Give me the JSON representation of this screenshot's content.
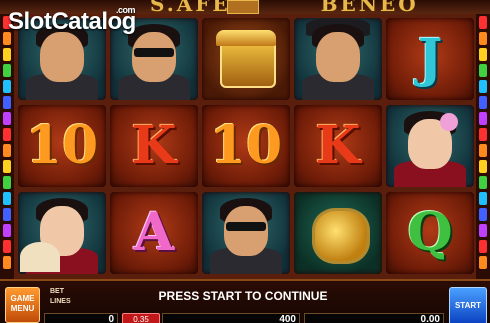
{
  "game": {
    "title_left": "S.AFE",
    "title_right": "BENEO"
  },
  "watermark": {
    "text": "SlotCatalog",
    "suffix": ".com"
  },
  "reels": {
    "columns": [
      [
        "mobster-cigar-portrait",
        "10",
        "geisha-fan-portrait"
      ],
      [
        "mobster-shades-portrait",
        "K",
        "A"
      ],
      [
        "treasure-chest",
        "10",
        "gunman-shades-portrait"
      ],
      [
        "gangster-fedora-portrait",
        "K",
        "fist"
      ],
      [
        "J",
        "geisha-flower-portrait",
        "Q"
      ]
    ],
    "symbol_colors": {
      "10": "orange",
      "K": "red",
      "A": "pink",
      "J": "teal",
      "Q": "green"
    }
  },
  "side_lights": [
    "#ff3030",
    "#ff8a20",
    "#ffd020",
    "#40d040",
    "#20c0ff",
    "#4060ff",
    "#c040ff",
    "#ff3030",
    "#ff8a20",
    "#ffd020",
    "#40d040",
    "#20c0ff",
    "#4060ff",
    "#c040ff",
    "#ff3030",
    "#ff8a20"
  ],
  "controls": {
    "menu_label_1": "GAME",
    "menu_label_2": "MENU",
    "bet_label": "BET",
    "lines_label": "LINES",
    "message": "PRESS START TO CONTINUE",
    "lines_value": "0",
    "bet_value": "0.35",
    "total_bet": "400",
    "win_value": "0.00",
    "start_label": "START"
  }
}
